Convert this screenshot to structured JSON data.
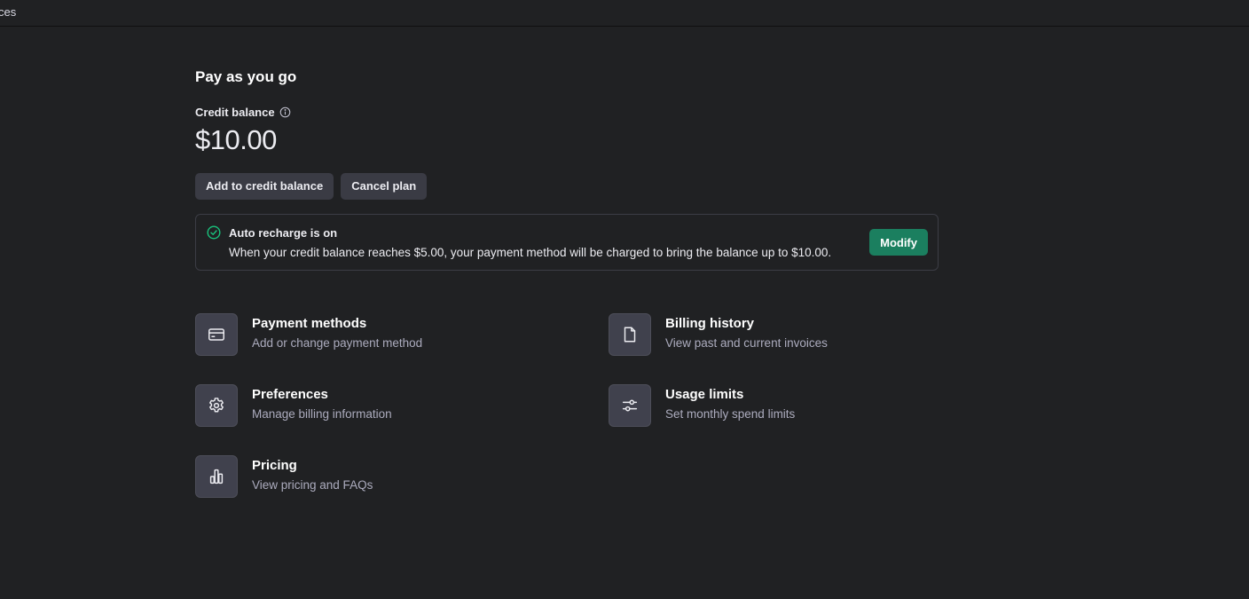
{
  "topbar": {
    "fragment": "ces"
  },
  "page": {
    "title": "Pay as you go"
  },
  "balance": {
    "label": "Credit balance",
    "amount": "$10.00"
  },
  "actions": {
    "add_label": "Add to credit balance",
    "cancel_label": "Cancel plan"
  },
  "recharge": {
    "title": "Auto recharge is on",
    "description": "When your credit balance reaches $5.00, your payment method will be charged to bring the balance up to $10.00.",
    "modify_label": "Modify"
  },
  "cards": [
    {
      "title": "Payment methods",
      "subtitle": "Add or change payment method",
      "icon": "credit-card-icon"
    },
    {
      "title": "Billing history",
      "subtitle": "View past and current invoices",
      "icon": "document-icon"
    },
    {
      "title": "Preferences",
      "subtitle": "Manage billing information",
      "icon": "gear-icon"
    },
    {
      "title": "Usage limits",
      "subtitle": "Set monthly spend limits",
      "icon": "sliders-icon"
    },
    {
      "title": "Pricing",
      "subtitle": "View pricing and FAQs",
      "icon": "bar-chart-icon"
    }
  ],
  "colors": {
    "background": "#202123",
    "button": "#3a3b44",
    "accent_green": "#1b7f5f",
    "check_green": "#19c37d",
    "muted_text": "#acacbe"
  }
}
